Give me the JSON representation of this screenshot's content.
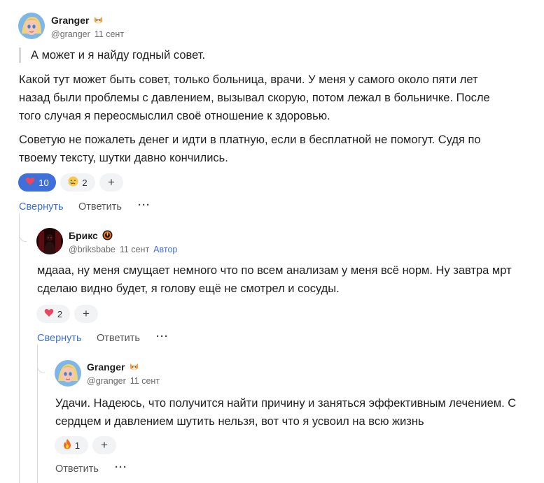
{
  "comments": [
    {
      "username": "Granger",
      "badge_icon": "shiba-dog-icon",
      "handle": "@granger",
      "date": "11 сент",
      "quote": "А может и я найду годный совет.",
      "paragraphs": [
        "Какой тут может быть совет, только больница, врачи. У меня у самого около пяти лет назад были проблемы с давлением, вызывал скорую, потом лежал в больничке. После того случая я переосмыслил своё отношение к здоровью.",
        "Советую не пожалеть денег и идти в платную, если в бесплатной не помогут. Судя по твоему тексту, шутки давно кончились."
      ],
      "reactions": [
        {
          "icon": "heart-icon",
          "count": "10",
          "active": true
        },
        {
          "icon": "crying-face-icon",
          "count": "2",
          "active": false
        }
      ],
      "add_reaction": "+",
      "collapse": "Свернуть",
      "reply": "Ответить",
      "more": "···"
    },
    {
      "username": "Брикс",
      "badge_icon": "flame-ring-icon",
      "handle": "@briksbabe",
      "date": "11 сент",
      "author_label": "Автор",
      "paragraphs": [
        "мдааа, ну меня смущает немного что по всем анализам у меня всё норм. Ну завтра мрт сделаю видно будет, я голову ещё не смотрел и сосуды."
      ],
      "reactions": [
        {
          "icon": "heart-icon",
          "count": "2",
          "active": false
        }
      ],
      "add_reaction": "+",
      "collapse": "Свернуть",
      "reply": "Ответить",
      "more": "···"
    },
    {
      "username": "Granger",
      "badge_icon": "shiba-dog-icon",
      "handle": "@granger",
      "date": "11 сент",
      "paragraphs": [
        "Удачи. Надеюсь, что получится найти причину и заняться эффективным лечением. С сердцем и давлением шутить нельзя, вот что я усвоил на всю жизнь"
      ],
      "reactions": [
        {
          "icon": "fire-icon",
          "count": "1",
          "active": false
        }
      ],
      "add_reaction": "+",
      "reply": "Ответить",
      "more": "···"
    }
  ],
  "colors": {
    "accent": "#3f6fd8",
    "heart": "#e8475f",
    "muted": "#6b6b6b"
  }
}
